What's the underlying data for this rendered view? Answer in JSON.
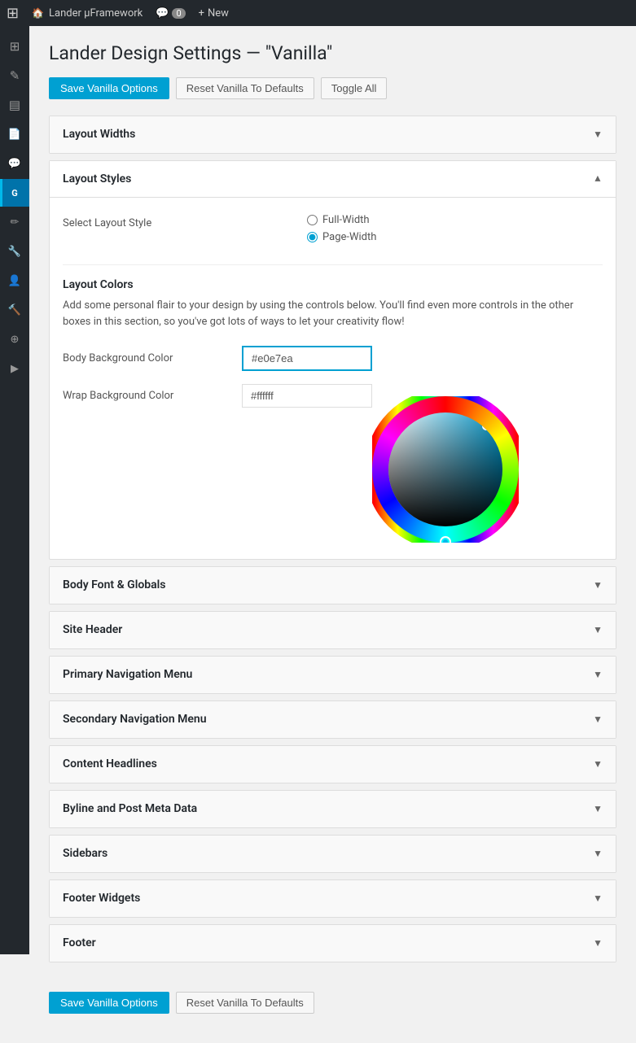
{
  "adminBar": {
    "logo": "⊞",
    "siteName": "Lander μFramework",
    "comments": "Comments",
    "commentCount": "0",
    "newLabel": "New"
  },
  "sidebar": {
    "items": [
      {
        "name": "dashboard-icon",
        "icon": "⊞",
        "active": false
      },
      {
        "name": "posts-icon",
        "icon": "✎",
        "active": false
      },
      {
        "name": "media-icon",
        "icon": "▤",
        "active": false
      },
      {
        "name": "pages-icon",
        "icon": "📄",
        "active": false
      },
      {
        "name": "comments-icon",
        "icon": "💬",
        "active": false
      },
      {
        "name": "plugin-icon",
        "icon": "G",
        "active": true
      },
      {
        "name": "appearance-icon",
        "icon": "✏",
        "active": false
      },
      {
        "name": "plugins-icon",
        "icon": "🔧",
        "active": false
      },
      {
        "name": "users-icon",
        "icon": "👤",
        "active": false
      },
      {
        "name": "tools-icon",
        "icon": "🔨",
        "active": false
      },
      {
        "name": "settings-icon",
        "icon": "⊕",
        "active": false
      },
      {
        "name": "play-icon",
        "icon": "▶",
        "active": false
      }
    ]
  },
  "page": {
    "title": "Lander Design Settings — \"Vanilla\"",
    "saveButton": "Save Vanilla Options",
    "resetButton": "Reset Vanilla To Defaults",
    "toggleButton": "Toggle All"
  },
  "sections": [
    {
      "id": "layout-widths",
      "label": "Layout Widths",
      "open": false
    },
    {
      "id": "layout-styles",
      "label": "Layout Styles",
      "open": true
    },
    {
      "id": "body-font-globals",
      "label": "Body Font & Globals",
      "open": false
    },
    {
      "id": "site-header",
      "label": "Site Header",
      "open": false
    },
    {
      "id": "primary-navigation",
      "label": "Primary Navigation Menu",
      "open": false
    },
    {
      "id": "secondary-navigation",
      "label": "Secondary Navigation Menu",
      "open": false
    },
    {
      "id": "content-headlines",
      "label": "Content Headlines",
      "open": false
    },
    {
      "id": "byline-post-meta",
      "label": "Byline and Post Meta Data",
      "open": false
    },
    {
      "id": "sidebars",
      "label": "Sidebars",
      "open": false
    },
    {
      "id": "footer-widgets",
      "label": "Footer Widgets",
      "open": false
    },
    {
      "id": "footer",
      "label": "Footer",
      "open": false
    }
  ],
  "layoutStyles": {
    "selectLabel": "Select Layout Style",
    "options": [
      {
        "label": "Full-Width",
        "value": "full-width",
        "checked": false
      },
      {
        "label": "Page-Width",
        "value": "page-width",
        "checked": true
      }
    ],
    "colorsTitle": "Layout Colors",
    "colorsDescription": "Add some personal flair to your design by using the controls below. You'll find even more controls in the other boxes in this section, so you've got lots of ways to let your creativity flow!",
    "bodyBgLabel": "Body Background Color",
    "bodyBgValue": "#e0e7ea",
    "wrapBgLabel": "Wrap Background Color",
    "wrapBgValue": "#ffffff"
  },
  "bottomBar": {
    "saveButton": "Save Vanilla Options",
    "resetButton": "Reset Vanilla To Defaults"
  }
}
